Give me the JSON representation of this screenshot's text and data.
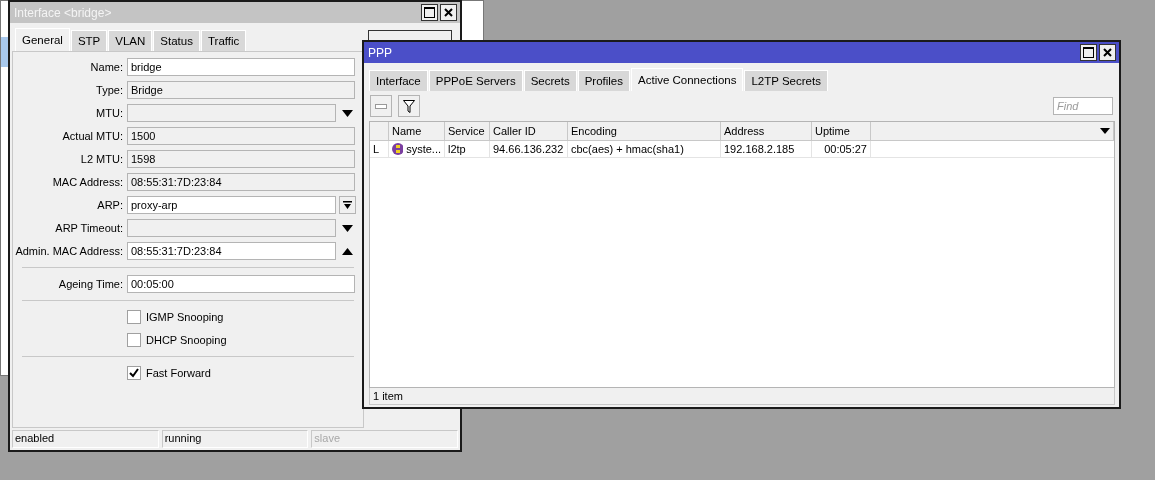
{
  "interface_window": {
    "title": "Interface <bridge>",
    "tabs": [
      {
        "label": "General",
        "selected": true
      },
      {
        "label": "STP",
        "selected": false
      },
      {
        "label": "VLAN",
        "selected": false
      },
      {
        "label": "Status",
        "selected": false
      },
      {
        "label": "Traffic",
        "selected": false
      }
    ],
    "sections": [
      {
        "fields": [
          {
            "label": "Name:",
            "value": "bridge",
            "editable": true,
            "kind": "plain"
          },
          {
            "label": "Type:",
            "value": "Bridge",
            "editable": false,
            "kind": "plain"
          },
          {
            "label": "MTU:",
            "editable": false,
            "kind": "dropdown"
          },
          {
            "label": "Actual MTU:",
            "value": "1500",
            "editable": false,
            "kind": "plain"
          },
          {
            "label": "L2 MTU:",
            "value": "1598",
            "editable": false,
            "kind": "plain"
          },
          {
            "label": "MAC Address:",
            "value": "08:55:31:7D:23:84",
            "editable": false,
            "kind": "plain"
          },
          {
            "label": "ARP:",
            "value": "proxy-arp",
            "editable": true,
            "kind": "combo"
          },
          {
            "label": "ARP Timeout:",
            "editable": false,
            "kind": "dropdown"
          },
          {
            "label": "Admin. MAC Address:",
            "value": "08:55:31:7D:23:84",
            "editable": true,
            "kind": "collapse"
          }
        ]
      },
      {
        "fields": [
          {
            "label": "Ageing Time:",
            "value": "00:05:00",
            "editable": true,
            "kind": "plain"
          }
        ]
      },
      {
        "checkboxes": [
          {
            "label": "IGMP Snooping",
            "checked": false
          },
          {
            "label": "DHCP Snooping",
            "checked": false
          }
        ]
      },
      {
        "checkboxes": [
          {
            "label": "Fast Forward",
            "checked": true
          }
        ]
      }
    ],
    "status_bar": [
      {
        "text": "enabled",
        "disabled": false
      },
      {
        "text": "running",
        "disabled": false
      },
      {
        "text": "slave",
        "disabled": true
      }
    ]
  },
  "ppp_window": {
    "title": "PPP",
    "tabs": [
      {
        "label": "Interface",
        "selected": false
      },
      {
        "label": "PPPoE Servers",
        "selected": false
      },
      {
        "label": "Secrets",
        "selected": false
      },
      {
        "label": "Profiles",
        "selected": false
      },
      {
        "label": "Active Connections",
        "selected": true
      },
      {
        "label": "L2TP Secrets",
        "selected": false
      }
    ],
    "find_placeholder": "Find",
    "table": {
      "columns": [
        "Name",
        "Service",
        "Caller ID",
        "Encoding",
        "Address",
        "Uptime"
      ],
      "rows": [
        {
          "flag": "L",
          "cells": [
            "syste...",
            "l2tp",
            "94.66.136.232",
            "cbc(aes) + hmac(sha1)",
            "192.168.2.185",
            "00:05:27"
          ]
        }
      ]
    },
    "status_bar": "1 item"
  }
}
